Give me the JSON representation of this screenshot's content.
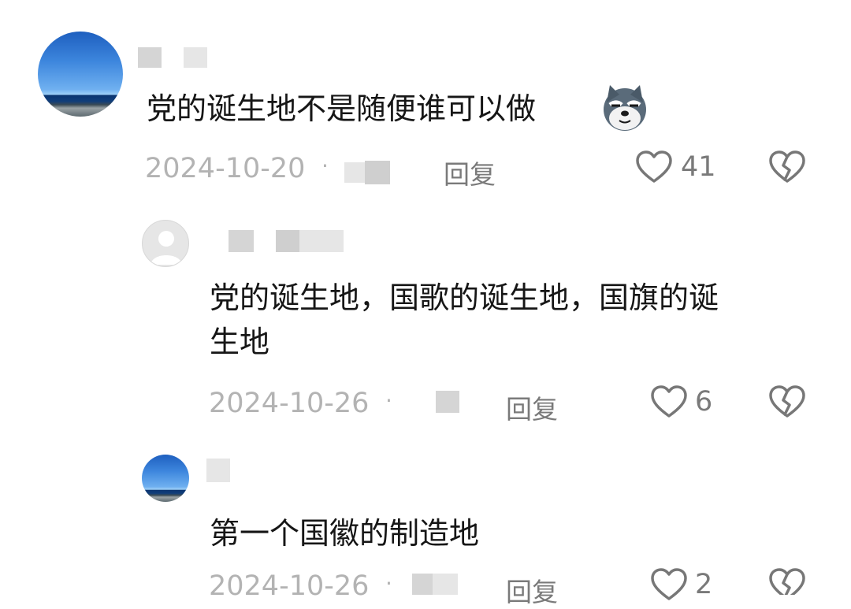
{
  "comments": [
    {
      "text": "党的诞生地不是随便谁可以做",
      "emoji": "husky-sly-emoji",
      "date": "2024-10-20",
      "separator": "·",
      "reply_label": "回复",
      "likes": "41"
    },
    {
      "text_line1": "党的诞生地，国歌的诞生地，国旗的诞",
      "text_line2": "生地",
      "date": "2024-10-26",
      "separator": "·",
      "reply_label": "回复",
      "likes": "6"
    },
    {
      "text": "第一个国徽的制造地",
      "date": "2024-10-26",
      "separator": "·",
      "reply_label": "回复",
      "likes": "2"
    }
  ],
  "colors": {
    "text": "#161616",
    "meta": "#b3b3b3",
    "action": "#7a7a7a",
    "blur": "#d5d5d5"
  }
}
